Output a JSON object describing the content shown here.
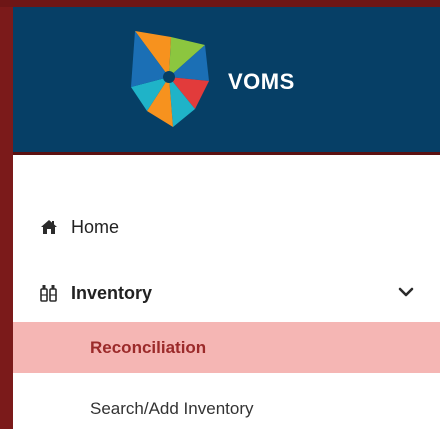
{
  "app": {
    "brand_name": "VOMS"
  },
  "nav": {
    "items": [
      {
        "label": "Home",
        "icon": "home-icon"
      },
      {
        "label": "Inventory",
        "icon": "bottles-icon",
        "expanded": true,
        "children": [
          {
            "label": "Reconciliation",
            "active": true
          },
          {
            "label": "Search/Add Inventory",
            "active": false
          }
        ]
      }
    ]
  },
  "colors": {
    "header_bg": "#063f66",
    "active_bg": "#f5b6b4",
    "active_text": "#9b2a2a",
    "frame": "#7b1a1a"
  }
}
